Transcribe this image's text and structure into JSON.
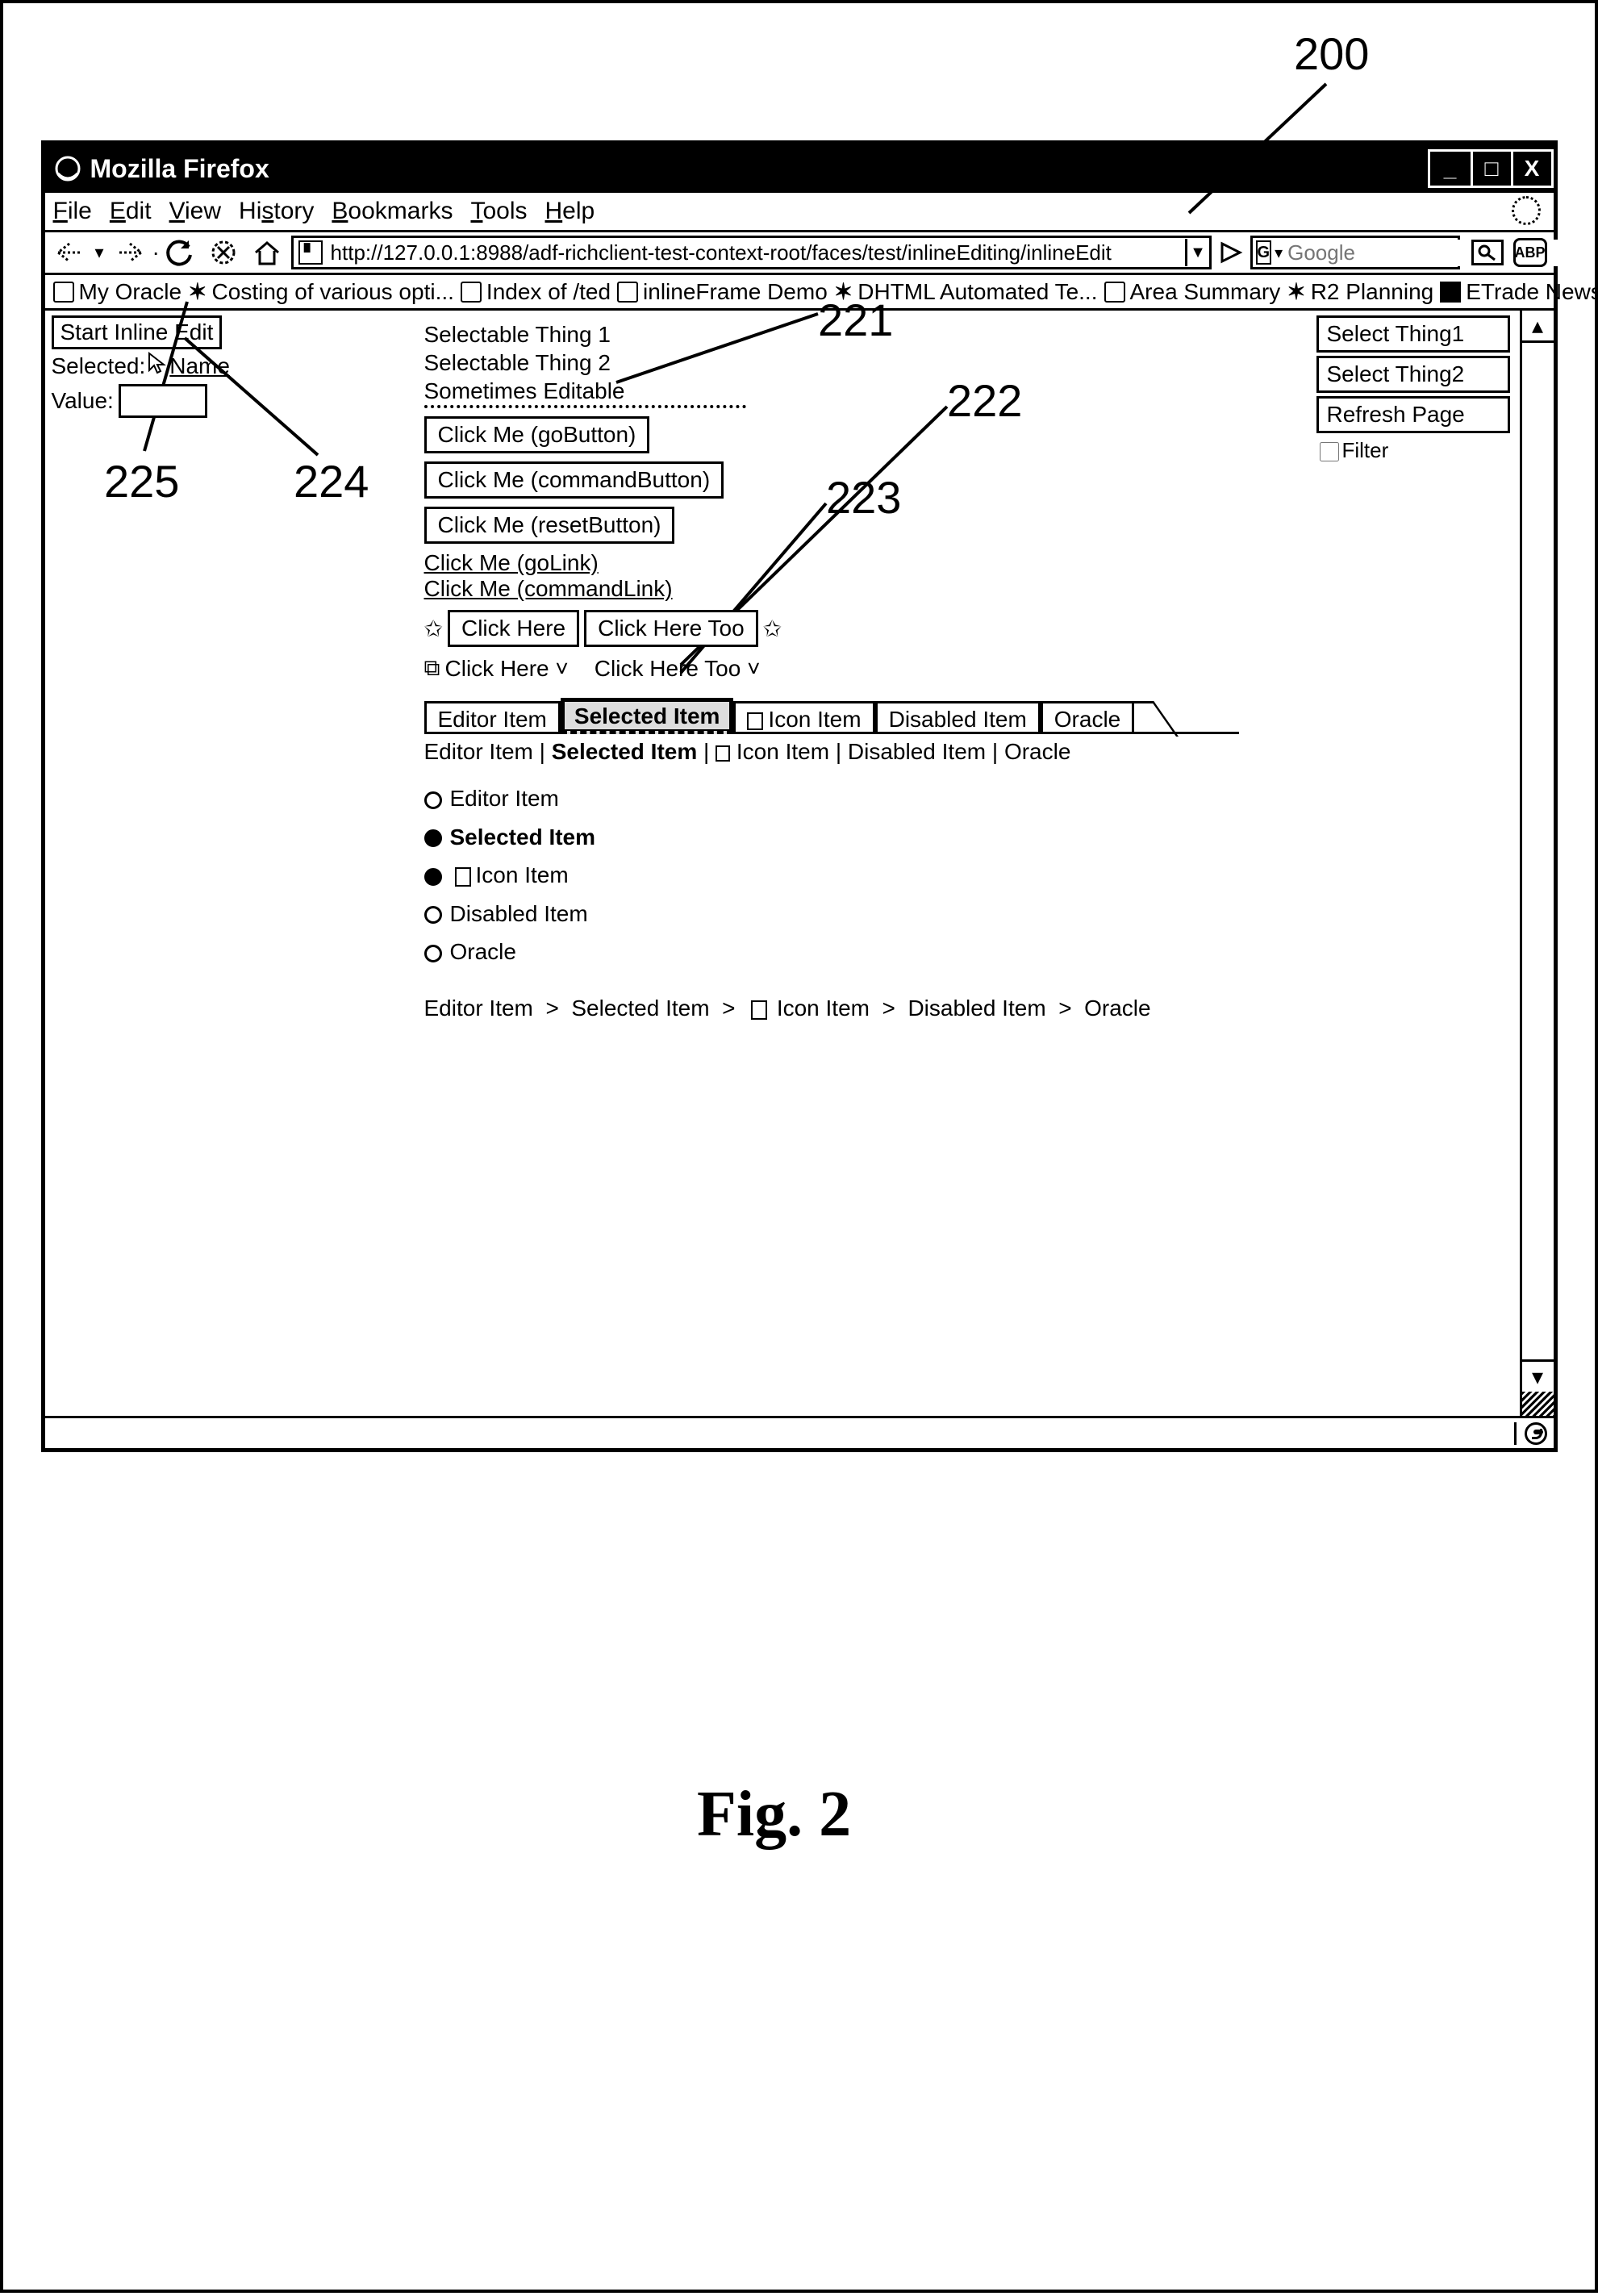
{
  "titlebar": {
    "app_name": "Mozilla Firefox"
  },
  "window_controls": {
    "min": "_",
    "max": "□",
    "close": "X"
  },
  "menubar": [
    "File",
    "Edit",
    "View",
    "History",
    "Bookmarks",
    "Tools",
    "Help"
  ],
  "toolbar": {
    "url": "http://127.0.0.1:8988/adf-richclient-test-context-root/faces/test/inlineEditing/inlineEdit",
    "search_engine_letter": "G",
    "search_placeholder": "Google",
    "abp_label": "ABP"
  },
  "bookmarks": [
    {
      "icon": "doc",
      "label": "My Oracle"
    },
    {
      "icon": "x",
      "label": "Costing of various opti..."
    },
    {
      "icon": "doc",
      "label": "Index of /ted"
    },
    {
      "icon": "doc",
      "label": "inlineFrame Demo"
    },
    {
      "icon": "x",
      "label": "DHTML Automated Te..."
    },
    {
      "icon": "doc",
      "label": "Area Summary"
    },
    {
      "icon": "x",
      "label": "R2 Planning"
    },
    {
      "icon": "pic",
      "label": "ETrade News - Topix"
    }
  ],
  "sidepanel": {
    "start_button": "Start Inline Edit",
    "selected_label": "Selected:",
    "selected_value": "Name",
    "value_label": "Value:"
  },
  "selectable": {
    "line1": "Selectable Thing 1",
    "line2": "Selectable Thing 2",
    "line3": "Sometimes Editable"
  },
  "buttons": {
    "go": "Click Me (goButton)",
    "cmd": "Click Me (commandButton)",
    "reset": "Click Me (resetButton)"
  },
  "links": {
    "golink": "Click Me (goLink)",
    "cmdlink": "Click Me (commandLink)"
  },
  "toolbar1": {
    "l1": "Click Here",
    "l2": "Click Here Too"
  },
  "toolbar2": {
    "l1": "Click Here",
    "l2": "Click Here Too",
    "chev": "˅"
  },
  "tabs": [
    "Editor Item",
    "Selected Item",
    "Icon Item",
    "Disabled Item",
    "Oracle"
  ],
  "pipelist": [
    "Editor Item",
    "Selected Item",
    "Icon Item",
    "Disabled Item",
    "Oracle"
  ],
  "train": [
    {
      "fill": false,
      "label": "Editor Item"
    },
    {
      "fill": true,
      "label": "Selected Item"
    },
    {
      "fill": true,
      "label": "Icon Item",
      "icon": true
    },
    {
      "fill": false,
      "label": "Disabled Item"
    },
    {
      "fill": false,
      "label": "Oracle"
    }
  ],
  "breadcrumb": "Editor Item  >  Selected Item  >       Icon Item  >  Disabled Item  >  Oracle",
  "right_panel": {
    "b1": "Select Thing1",
    "b2": "Select Thing2",
    "b3": "Refresh Page",
    "filter": "Filter"
  },
  "callouts": {
    "c200": "200",
    "c221": "221",
    "c222": "222",
    "c223": "223",
    "c224": "224",
    "c225": "225"
  },
  "figure_caption": "Fig. 2"
}
